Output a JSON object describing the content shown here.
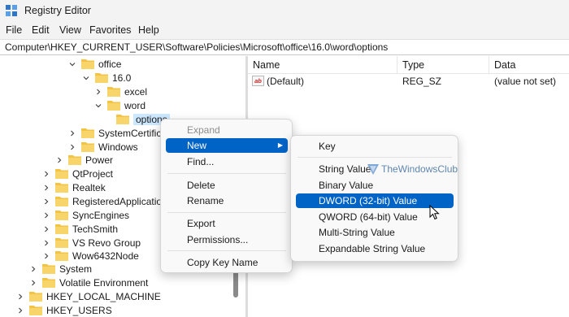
{
  "window": {
    "title": "Registry Editor"
  },
  "menu": [
    "File",
    "Edit",
    "View",
    "Favorites",
    "Help"
  ],
  "address": "Computer\\HKEY_CURRENT_USER\\Software\\Policies\\Microsoft\\office\\16.0\\word\\options",
  "tree": {
    "office": "office",
    "v16": "16.0",
    "excel": "excel",
    "word": "word",
    "options": "options",
    "systemcert": "SystemCertificat",
    "windows": "Windows",
    "power": "Power",
    "qtproject": "QtProject",
    "realtek": "Realtek",
    "registeredapp": "RegisteredApplication",
    "syncengines": "SyncEngines",
    "techsmith": "TechSmith",
    "vsrevo": "VS Revo Group",
    "wow": "Wow6432Node",
    "system": "System",
    "volatile": "Volatile Environment",
    "hklm": "HKEY_LOCAL_MACHINE",
    "hku": "HKEY_USERS"
  },
  "list": {
    "headers": {
      "name": "Name",
      "type": "Type",
      "data": "Data"
    },
    "rows": [
      {
        "name": "(Default)",
        "type": "REG_SZ",
        "data": "(value not set)",
        "icon": "ab"
      }
    ]
  },
  "context_menu": {
    "expand": "Expand",
    "new": "New",
    "find": "Find...",
    "delete": "Delete",
    "rename": "Rename",
    "export": "Export",
    "permissions": "Permissions...",
    "copy_key_name": "Copy Key Name"
  },
  "submenu": {
    "key": "Key",
    "string_value": "String Value",
    "binary_value": "Binary Value",
    "dword_value": "DWORD (32-bit) Value",
    "qword_value": "QWORD (64-bit) Value",
    "multi_string": "Multi-String Value",
    "expandable_string": "Expandable String Value"
  },
  "watermark": "TheWindowsClub",
  "colors": {
    "selection": "#0063c6",
    "tree_selection": "#cce8ff",
    "folder": "#f3c343"
  }
}
